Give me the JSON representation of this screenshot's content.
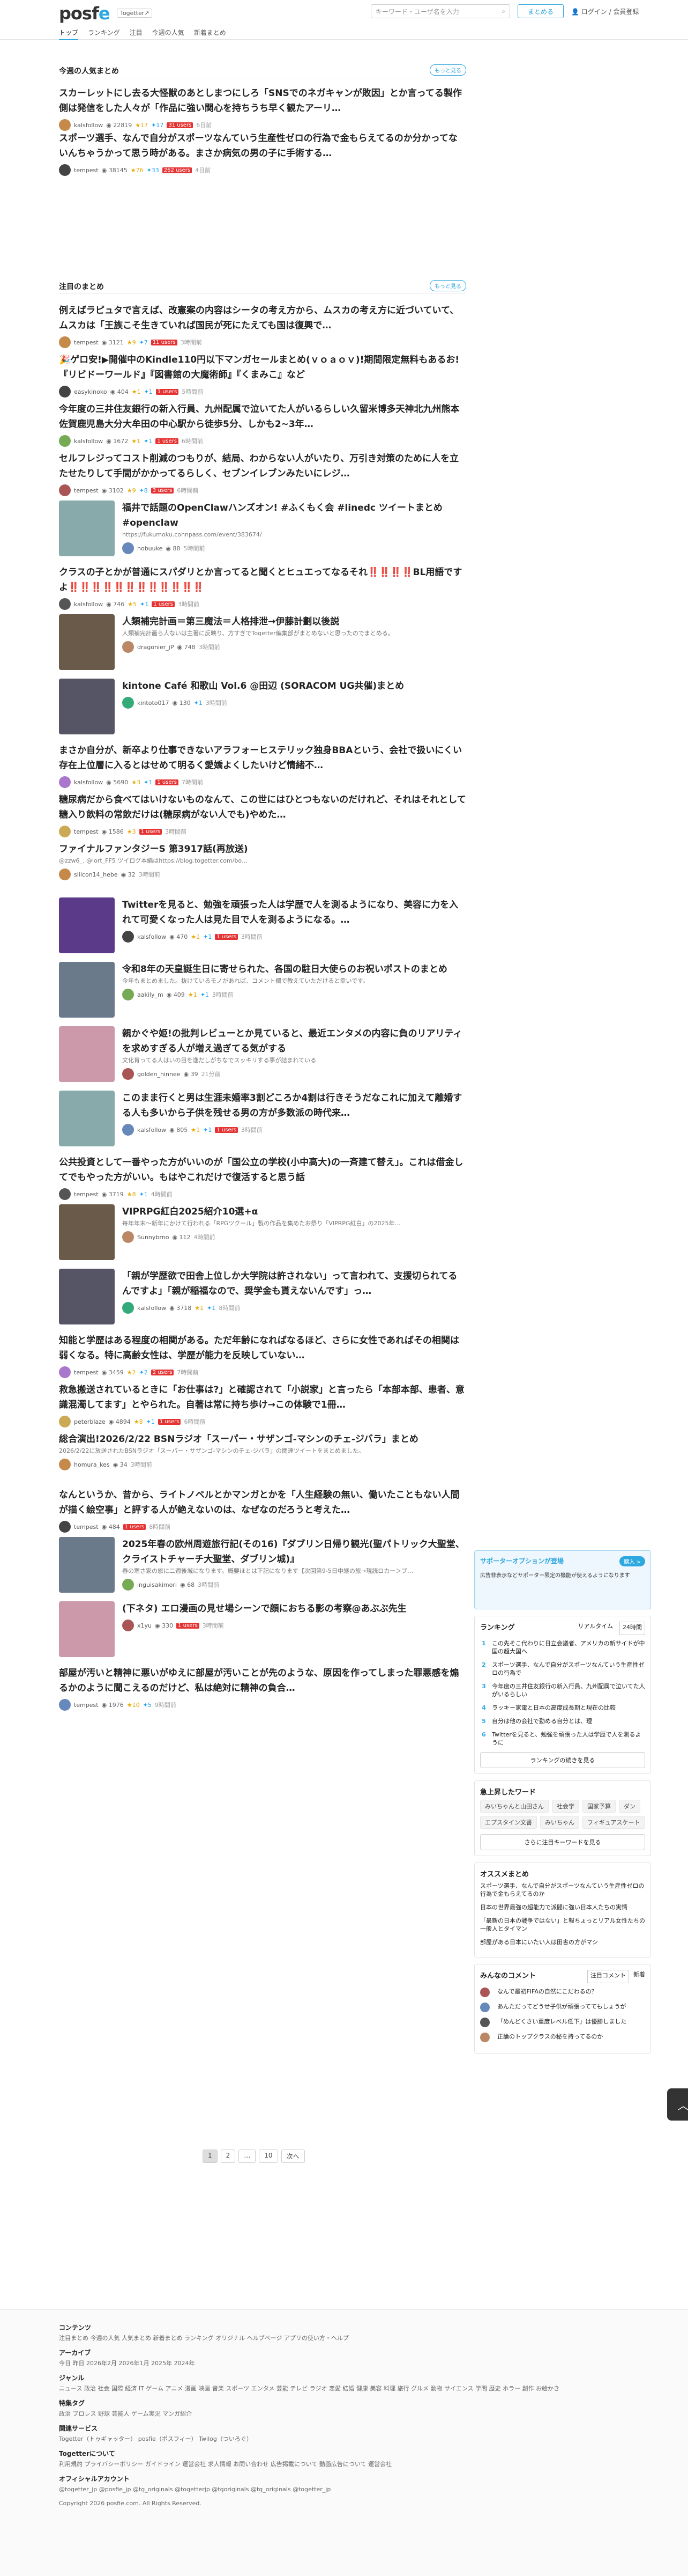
{
  "header": {
    "logo_pre": "posf",
    "logo_post": "e",
    "togetter": "Togetter↗",
    "search_placeholder": "キーワード・ユーザ名を入力",
    "create": "まとめる",
    "login": "ログイン / 会員登録",
    "nav": [
      "トップ",
      "ランキング",
      "注目",
      "今週の人気",
      "新着まとめ"
    ]
  },
  "popular": {
    "title": "今週の人気まとめ",
    "more": "もっと見る",
    "items": [
      {
        "title": "スカーレットにし去る大怪獣のあとしまつにしろ「SNSでのネガキャンが敗因」とか言ってる製作側は発信をした人々が「作品に強い関心を持ちうち早く観たアーリ…",
        "user": "kalsfollow",
        "pv": "22819",
        "stars": "17",
        "rts": "17",
        "red": "31 users",
        "time": "6日前"
      },
      {
        "title": "スポーツ選手、なんで自分がスポーツなんていう生産性ゼロの行為で金もらえてるのか分かってないんちゃうかって思う時がある。まさか病気の男の子に手術する…",
        "user": "tempest",
        "pv": "38145",
        "stars": "76",
        "rts": "33",
        "red": "262 users",
        "time": "4日前"
      }
    ]
  },
  "attention": {
    "title": "注目のまとめ",
    "more": "もっと見る",
    "items": [
      {
        "title": "例えばラピュタで言えば、改憲案の内容はシータの考え方から、ムスカの考え方に近づいていて、ムスカは「王族こそ生きていれば国民が死にたえても国は復興で…",
        "sub": "",
        "user": "tempest",
        "pv": "3121",
        "stars": "9",
        "rts": "7",
        "red": "11 users",
        "time": "3時間前"
      },
      {
        "title": "🎉ゲロ安!▶開催中のKindle110円以下マンガセールまとめ(ｖｏａｏｖ)!期間限定無料もあるお!『リビドーワールド』『図書館の大魔術師』『くまみこ』など",
        "sub": "",
        "user": "easykinoko",
        "pv": "404",
        "stars": "1",
        "rts": "1",
        "red": "1 users",
        "time": "5時間前"
      },
      {
        "title": "今年度の三井住友銀行の新入行員、九州配属で泣いてた人がいるらしい久留米博多天神北九州熊本佐賀鹿児島大分大牟田の中心駅から徒歩5分、しかも2~3年…",
        "sub": "",
        "user": "kalsfollow",
        "pv": "1672",
        "stars": "1",
        "rts": "1",
        "red": "1 users",
        "time": "6時間前"
      },
      {
        "title": "セルフレジってコスト削減のつもりが、結局、わからない人がいたり、万引き対策のために人を立たせたりして手間がかかってるらしく、セブンイレブンみたいにレジ…",
        "sub": "",
        "user": "tempest",
        "pv": "3102",
        "stars": "9",
        "rts": "8",
        "red": "3 users",
        "time": "6時間前"
      },
      {
        "title": "福井で話題のOpenClawハンズオン! #ふくもく会 #linedc ツイートまとめ #openclaw",
        "sub": "https://fukumoku.connpass.com/event/383674/",
        "user": "nobuuke",
        "pv": "88",
        "stars": "",
        "rts": "",
        "red": "",
        "time": "5時間前"
      },
      {
        "title": "クラスの子とかが普通にスパダリとか言ってると聞くとヒュエってなるそれ‼️‼️‼️‼️BL用語ですよ‼️‼️‼️‼️‼️‼️‼️‼️‼️‼️‼️‼️",
        "sub": "",
        "user": "kalsfollow",
        "pv": "746",
        "stars": "5",
        "rts": "1",
        "red": "1 users",
        "time": "3時間前"
      },
      {
        "title": "人類補完計画＝第三魔法＝人格排泄→伊藤計劃以後説",
        "sub": "人類補完計画ら人ないは主著に反映り、方すぎでTogetter編集部がまとめないと思ったのでまとめる。",
        "user": "dragonier_jP",
        "pv": "748",
        "stars": "",
        "rts": "",
        "red": "",
        "time": "3時間前"
      },
      {
        "title": "kintone Café 和歌山 Vol.6 @田辺 (SORACOM UG共催)まとめ",
        "sub": "",
        "user": "kintoto017",
        "pv": "130",
        "stars": "",
        "rts": "1",
        "red": "",
        "time": "3時間前"
      },
      {
        "title": "まさか自分が、新卒より仕事できないアラフォーヒステリック独身BBAという、会社で扱いにくい存在上位層に入るとはせめて明るく愛嬌よくしたいけど情緒不…",
        "sub": "",
        "user": "kalsfollow",
        "pv": "5690",
        "stars": "3",
        "rts": "1",
        "red": "1 users",
        "time": "7時間前"
      },
      {
        "title": "糖尿病だから食べてはいけないものなんて、この世にはひとつもないのだけれど、それはそれとして糖入り飲料の常飲だけは(糖尿病がない人でも)やめた…",
        "sub": "",
        "user": "tempest",
        "pv": "1586",
        "stars": "3",
        "rts": "",
        "red": "1 users",
        "time": "3時間前"
      },
      {
        "title": "ファイナルファンタジーS 第3917話(再放送)",
        "sub": "@zzw6_. @lort_FF5 ツイログ本編はhttps://blog.togetter.com/bo…",
        "user": "silicon14_hebe",
        "pv": "32",
        "stars": "",
        "rts": "",
        "red": "",
        "time": "3時間前"
      },
      {
        "title": "Twitterを見ると、勉強を頑張った人は学歴で人を測るようになり、美容に力を入れて可愛くなった人は見た目で人を測るようになる。…",
        "sub": "",
        "user": "kalsfollow",
        "pv": "470",
        "stars": "1",
        "rts": "1",
        "red": "1 users",
        "time": "3時間前"
      },
      {
        "title": "令和8年の天皇誕生日に寄せられた、各国の駐日大使らのお祝いポストのまとめ",
        "sub": "今年もまとめました。抜けているモノがあれば、コメント欄で教えていただけると幸いです。",
        "user": "aakily_m",
        "pv": "409",
        "stars": "1",
        "rts": "1",
        "red": "",
        "time": "3時間前"
      },
      {
        "title": "親かぐや姫!の批判レビューとか見ていると、最近エンタメの内容に負のリアリティを求めすぎる人が増え過ぎてる気がする",
        "sub": "文化育ってる人はいの目を逸だしがちなでスッキリする事が詰まれている",
        "user": "golden_hinnee",
        "pv": "39",
        "stars": "",
        "rts": "",
        "red": "",
        "time": "21分前"
      },
      {
        "title": "このまま行くと男は生涯未婚率3割どころか4割は行きそうだなこれに加えて離婚する人も多いから子供を残せる男の方が多数派の時代来…",
        "sub": "",
        "user": "kalsfollow",
        "pv": "805",
        "stars": "1",
        "rts": "1",
        "red": "1 users",
        "time": "3時間前"
      },
      {
        "title": "公共投資として一番やった方がいいのが「国公立の学校(小中高大)の一斉建て替え」。これは借金してでもやった方がいい。もはやこれだけで復活すると思う話",
        "sub": "",
        "user": "tempest",
        "pv": "3719",
        "stars": "8",
        "rts": "1",
        "red": "",
        "time": "4時間前"
      },
      {
        "title": "VIPRPG紅白2025紹介10選+α",
        "sub": "毎年年末〜新年にかけて行われる「RPGツクール」製の作品を集めたお祭り「VIPRPG紅白」の2025年…",
        "user": "Sunnybrno",
        "pv": "112",
        "stars": "",
        "rts": "",
        "red": "",
        "time": "4時間前"
      },
      {
        "title": "「親が学歴欲で田舎上位しか大学院は許されない」って言われて、支援切られてるんですよ」「親が稲福なので、奨学金も貰えないんです」っ…",
        "sub": "",
        "user": "kalsfollow",
        "pv": "3718",
        "stars": "1",
        "rts": "1",
        "red": "",
        "time": "8時間前"
      },
      {
        "title": "知能と学歴はある程度の相関がある。ただ年齢になればなるほど、さらに女性であればその相関は弱くなる。特に高齢女性は、学歴が能力を反映していない…",
        "sub": "",
        "user": "tempest",
        "pv": "3459",
        "stars": "2",
        "rts": "2",
        "red": "2 users",
        "time": "7時間前"
      },
      {
        "title": "救急搬送されているときに「お仕事は?」と確認されて「小説家」と言ったら「本部本部、患者、意識混濁してます」とやられた。自著は常に持ち歩け→この体験で1冊…",
        "sub": "",
        "user": "peterblaze",
        "pv": "4894",
        "stars": "8",
        "rts": "1",
        "red": "1 users",
        "time": "6時間前"
      },
      {
        "title": "総合演出!2026/2/22 BSNラジオ「スーパー・サザンゴ-マシンのチェ-ジバラ」まとめ",
        "sub": "2026/2/22に放送されたBSNラジオ「スーパー・サザンゴ-マシンのチェ-ジバラ」の関連ツイートをまとめました。",
        "user": "homura_kes",
        "pv": "34",
        "stars": "",
        "rts": "",
        "red": "",
        "time": "3時間前"
      },
      {
        "title": "なんというか、昔から、ライトノベルとかマンガとかを「人生経験の無い、働いたこともない人間が描く絵空事」と評する人が絶えないのは、なぜなのだろうと考えた…",
        "sub": "",
        "user": "tempest",
        "pv": "484",
        "stars": "",
        "rts": "",
        "red": "1 users",
        "time": "8時間前"
      },
      {
        "title": "2025年春の欧州周遊旅行記(その16)『ダブリン日帰り観光(聖パトリック大聖堂、クライストチャーチ大聖堂、ダブリン城)』",
        "sub": "春の寒さ家の旅に二週後城になります。概要ほとは下記になります【次回第9-5日中継の旅→現読ロカー＞プ…",
        "user": "inguisakimori",
        "pv": "68",
        "stars": "",
        "rts": "",
        "red": "",
        "time": "3時間前"
      },
      {
        "title": "(下ネタ) エロ漫画の見せ場シーンで顔におちる影の考察@あぶぶ先生",
        "sub": "",
        "user": "x1yu",
        "pv": "330",
        "stars": "",
        "rts": "",
        "red": "1 users",
        "time": "3時間前"
      },
      {
        "title": "部屋が汚いと精神に悪いがゆえに部屋が汚いことが先のような、原因を作ってしまった罪悪感を煽るかのように聞こえるのだけど、私は絶対に精神の負合…",
        "sub": "",
        "user": "tempest",
        "pv": "1976",
        "stars": "10",
        "rts": "5",
        "red": "",
        "time": "9時間前"
      }
    ]
  },
  "pager": [
    "1",
    "2",
    "…",
    "10",
    "次へ"
  ],
  "side": {
    "support": {
      "title": "サポーターオプションが登場",
      "btn": "購入 >",
      "text": "広告非表示などサポーター限定の機能が使えるようになります"
    },
    "ranking": {
      "title": "ランキング",
      "tabs": [
        "リアルタイム",
        "24時間"
      ],
      "items": [
        "この先そこ代わりに日立会議者、アメリカの新サイドが中国の超大国へ",
        "スポーツ選手、なんで自分がスポーツなんていう生産性ゼロの行為で",
        "今年度の三井住友銀行の新入行員、九州配属で泣いてた人がいるらしい",
        "ラッキー家電と日本の高度成長期と現在の比較",
        "自分は他の会社で勤める自分とは、理",
        "Twitterを見ると、勉強を頑張った人は学歴で人を測るように"
      ],
      "more": "ランキングの続きを見る"
    },
    "keywords": {
      "title": "急上昇したワード",
      "items": [
        "みいちゃんと山田さん",
        "社会学",
        "国家予算",
        "ダン",
        "エプスタイン文書",
        "みいちゃん",
        "フィギュアスケート"
      ],
      "more": "さらに注目キーワードを見る"
    },
    "recommend": {
      "title": "オススメまとめ",
      "items": [
        "スポーツ選手、なんで自分がスポーツなんていう生産性ゼロの行為で金もらえてるのか",
        "日本の世界最強の超能力で派閥に強い日本人たちの実情",
        "「最新の日本の戦争ではない」と報ちょっとリアル女性たちの一般人とタイマン",
        "部屋がある日本にいたい人は田舎の方がマシ"
      ]
    },
    "comments": {
      "title": "みんなのコメント",
      "tabs": [
        "注目コメント",
        "新着"
      ],
      "items": [
        "なんで最初FIFAの自然にこだわるの？",
        "あんただってどうせ子供が頑張っててもしょうが",
        "「めんどくさい重度レベル低下」は優勝しました",
        "正論のトップクラスの秘を持ってるのか"
      ]
    }
  },
  "footer": {
    "sections": [
      {
        "title": "コンテンツ",
        "text": "注目まとめ  今週の人気  人気まとめ  新着まとめ  ランキング  オリジナル  ヘルプページ  アプリの使い方・ヘルプ"
      },
      {
        "title": "アーカイブ",
        "text": "今日  昨日  2026年2月  2026年1月  2025年  2024年"
      },
      {
        "title": "ジャンル",
        "text": "ニュース  政治  社会  国際  経済  IT  ゲーム  アニメ  漫画  映画  音楽  スポーツ  エンタメ  芸能  テレビ  ラジオ  恋愛  結婚  健康  美容  料理  旅行  グルメ  動物  サイエンス  学問  歴史  ホラー  創作  お絵かき"
      },
      {
        "title": "特集タグ",
        "text": "政治  ブロレス  野球  芸能人  ゲーム実況  マンガ紹介"
      },
      {
        "title": "関連サービス",
        "text": "Togetter（トゥギャッター）  posfie（ポスフィー）  Twilog（ついろぐ）"
      },
      {
        "title": "Togetterについて",
        "text": "利用規約  プライバシーポリシー  ガイドライン  運営会社  求人情報  お問い合わせ  広告掲載について  動画広告について  運営会社"
      },
      {
        "title": "オフィシャルアカウント",
        "text": "@togetter_jp  @posfie_jp  @tg_originals  @togetterjp  @tgoriginals  @tg_originals  @togetter_jp"
      }
    ],
    "copyright": "Copyright 2026 posfie.com. All Rights Reserved."
  }
}
